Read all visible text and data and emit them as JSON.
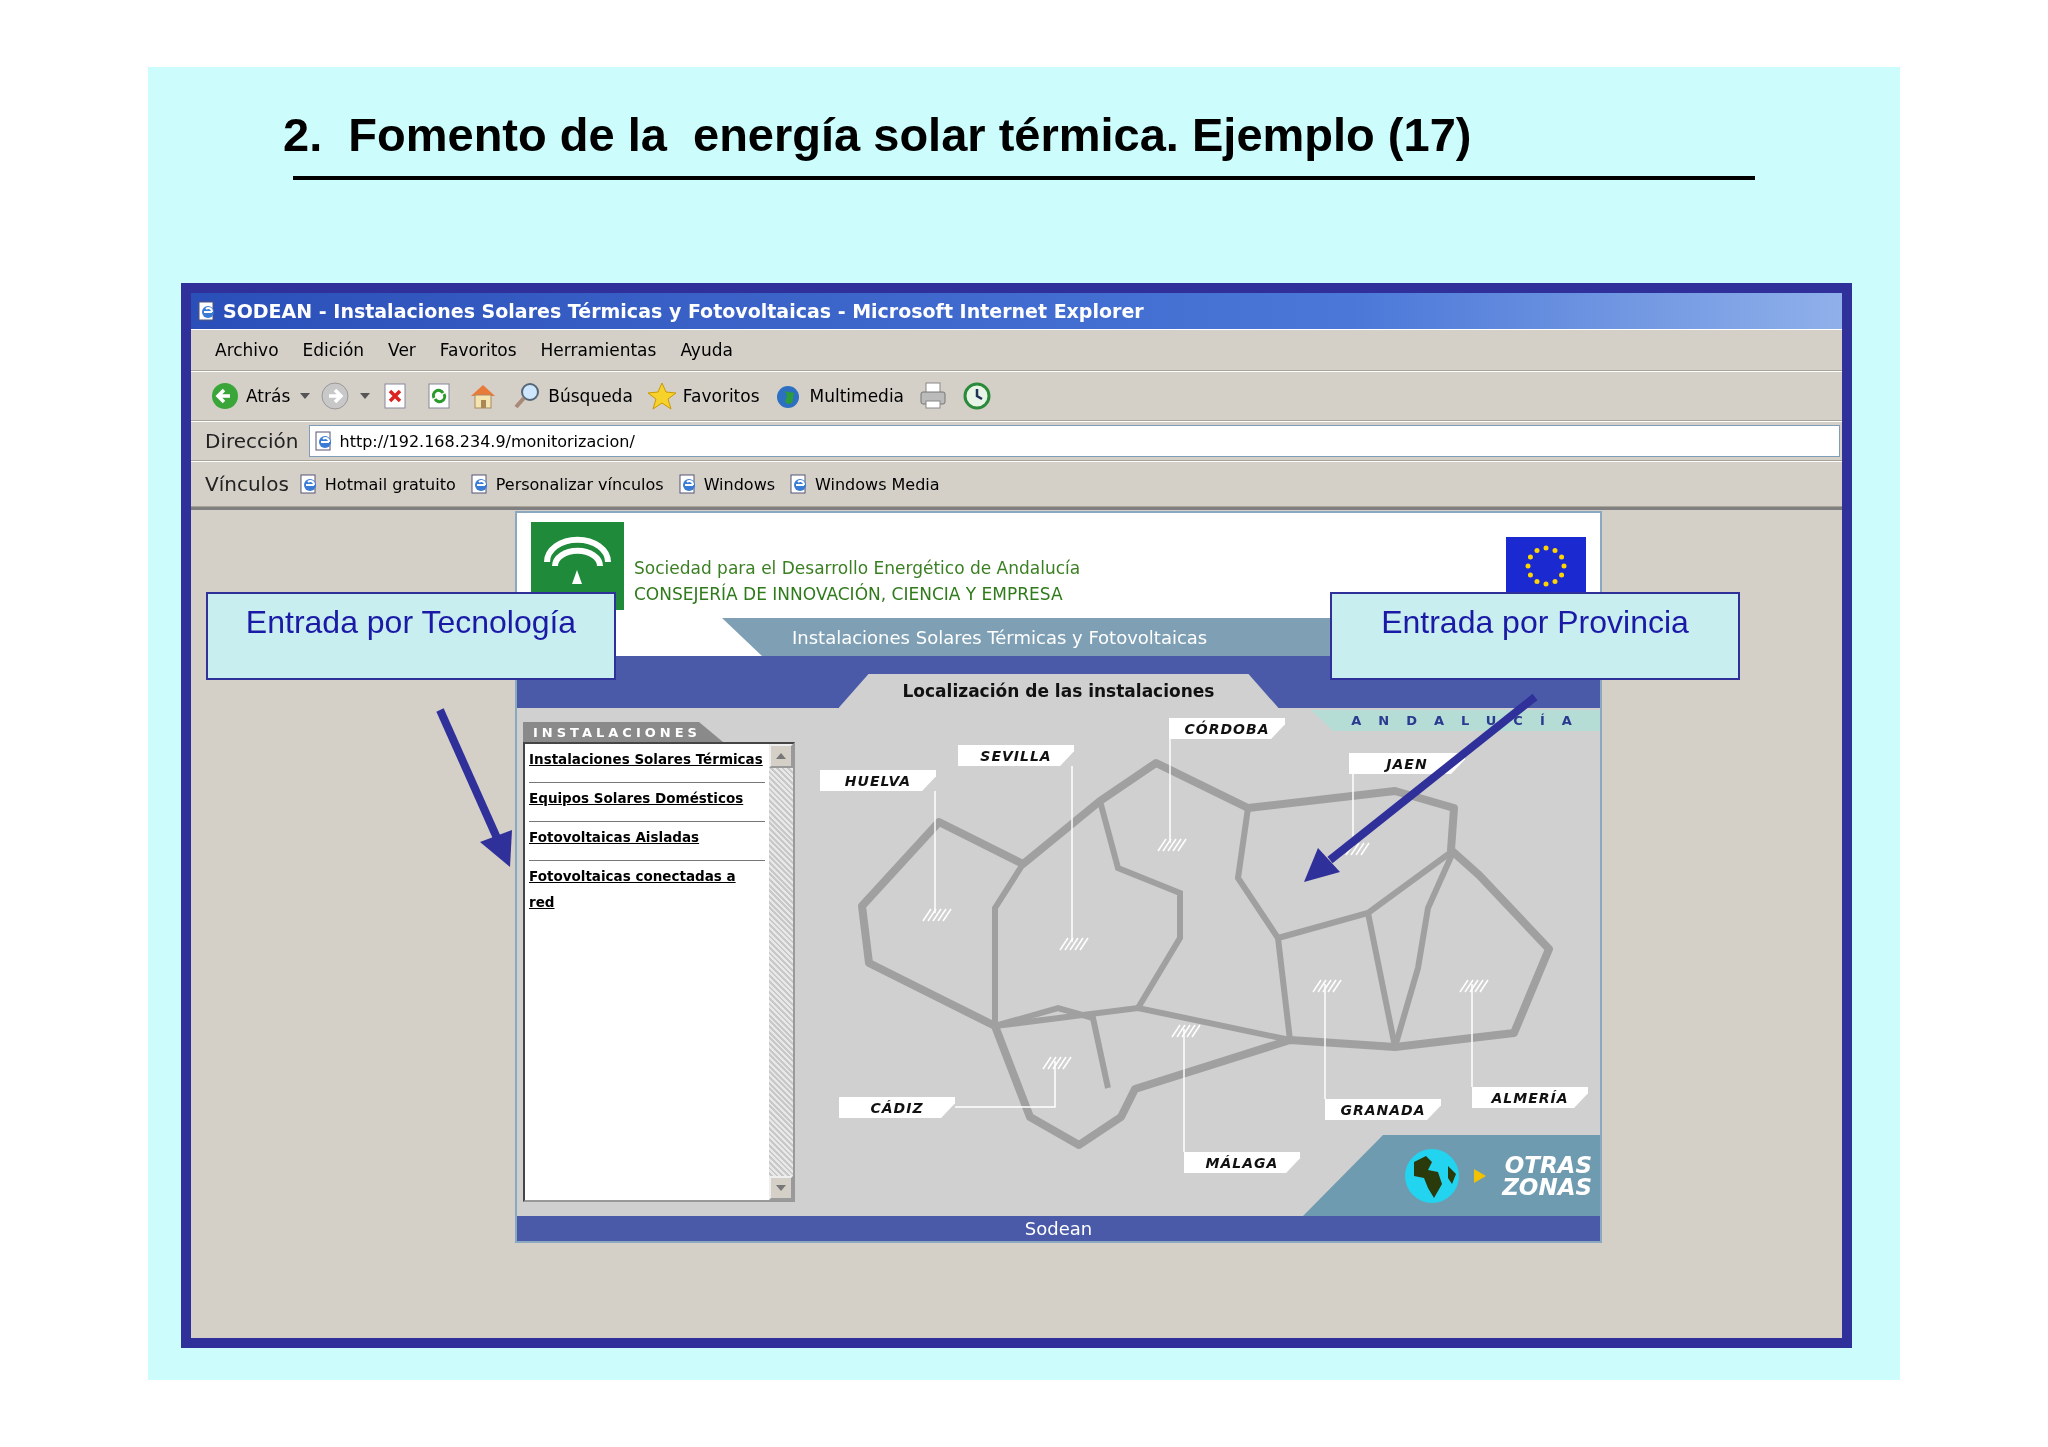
{
  "slide_title": "2.  Fomento de la  energía solar térmica. Ejemplo (17)",
  "browser": {
    "title": "SODEAN - Instalaciones Solares Térmicas y Fotovoltaicas - Microsoft Internet Explorer",
    "menu": [
      "Archivo",
      "Edición",
      "Ver",
      "Favoritos",
      "Herramientas",
      "Ayuda"
    ],
    "toolbar": [
      {
        "kind": "back",
        "label": "Atrás",
        "has_menu": true
      },
      {
        "kind": "forward",
        "has_menu": true
      },
      {
        "kind": "stop",
        "has_menu": false
      },
      {
        "kind": "refresh",
        "has_menu": false
      },
      {
        "kind": "home",
        "has_menu": false
      },
      {
        "kind": "search",
        "label": "Búsqueda",
        "has_menu": false
      },
      {
        "kind": "favorites",
        "label": "Favoritos",
        "has_menu": false
      },
      {
        "kind": "media",
        "label": "Multimedia",
        "has_menu": false
      },
      {
        "kind": "print",
        "has_menu": false
      },
      {
        "kind": "history",
        "has_menu": false
      }
    ],
    "address_label": "Dirección",
    "address": "http://192.168.234.9/monitorizacion/",
    "links_label": "Vínculos",
    "links": [
      "Hotmail gratuito",
      "Personalizar vínculos",
      "Windows",
      "Windows Media"
    ]
  },
  "page": {
    "org_name": "Sociedad para el Desarrollo Energético de Andalucía",
    "ministry": "CONSEJERÍA DE INNOVACIÓN, CIENCIA Y EMPRESA",
    "banner": "Instalaciones Solares Térmicas y Fotovoltaicas",
    "section_tab": "Localización de las instalaciones",
    "list_title": "INSTALACIONES",
    "list_items": [
      "Instalaciones Solares Térmicas",
      "Equipos Solares Domésticos",
      "Fotovoltaicas Aisladas",
      "Fotovoltaicas conectadas a red"
    ],
    "region": "ANDALUCÍA",
    "provinces": [
      "HUELVA",
      "SEVILLA",
      "CÓRDOBA",
      "JAEN",
      "CÁDIZ",
      "MÁLAGA",
      "GRANADA",
      "ALMERÍA"
    ],
    "other_zones": "OTRAS ZONAS",
    "footer": "Sodean"
  },
  "callouts": [
    "Entrada por Tecnología",
    "Entrada por Provincia"
  ]
}
